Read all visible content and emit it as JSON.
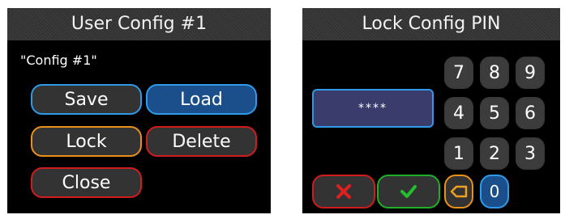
{
  "user_config": {
    "title": "User Config #1",
    "config_name": "\"Config #1\"",
    "buttons": {
      "save": "Save",
      "load": "Load",
      "lock": "Lock",
      "delete": "Delete",
      "close": "Close"
    }
  },
  "lock_pin": {
    "title": "Lock Config PIN",
    "pin_masked": "****",
    "keys": [
      "7",
      "8",
      "9",
      "4",
      "5",
      "6",
      "1",
      "2",
      "3",
      "0"
    ],
    "icons": {
      "cancel": "close-x-icon",
      "confirm": "checkmark-icon",
      "backspace": "backspace-icon"
    }
  },
  "colors": {
    "blue_border": "#2e9ae8",
    "orange_border": "#e8901a",
    "red_border": "#d01c1c",
    "green_border": "#1fae2a",
    "pin_field_bg": "#3a3d6b"
  }
}
